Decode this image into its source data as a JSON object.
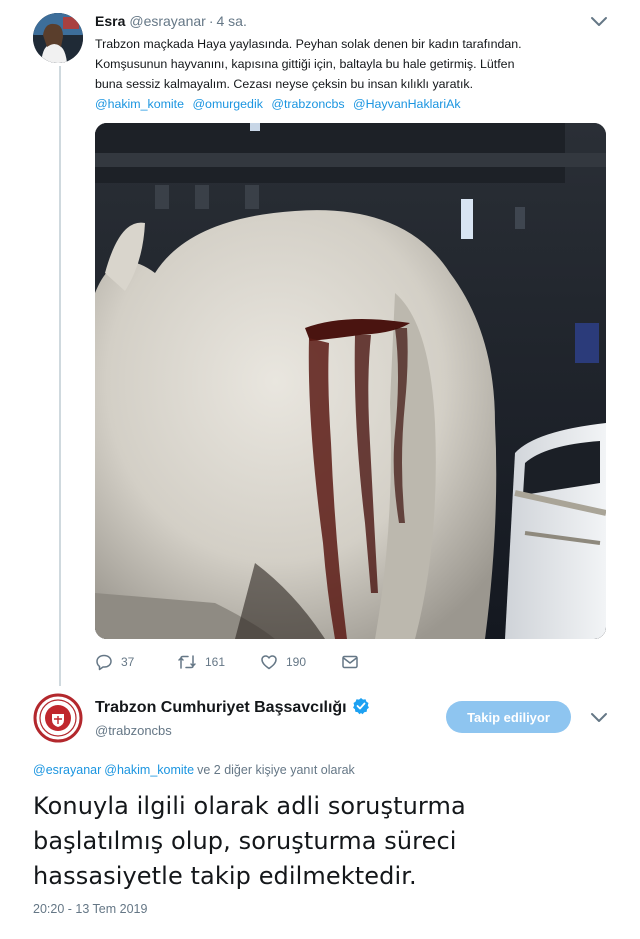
{
  "tweet": {
    "author_name": "Esra",
    "author_handle": "@esrayanar",
    "separator": "·",
    "time": "4 sa.",
    "text_lines": [
      "Trabzon maçkada Haya yaylasında. Peyhan solak denen bir kadın tarafından.",
      "Komşusunun hayvanını, kapısına gittiği için, baltayla bu hale getirmiş. Lütfen",
      "buna sessiz kalmayalım. Cezası neyse çeksin bu insan kılıklı yaratık."
    ],
    "mentions": [
      "@hakim_komite",
      "@omurgedik",
      "@trabzoncbs",
      "@HayvanHaklariAk"
    ],
    "actions": {
      "reply_count": "37",
      "retweet_count": "161",
      "like_count": "190"
    },
    "icons": {
      "reply": "reply-icon",
      "retweet": "retweet-icon",
      "like": "heart-icon",
      "message": "envelope-icon",
      "more": "chevron-down-icon"
    }
  },
  "reply": {
    "author_name": "Trabzon Cumhuriyet Başsavcılığı",
    "author_handle": "@trabzoncbs",
    "verified_icon": "verified-badge-icon",
    "follow_label": "Takip ediliyor",
    "reply_to": {
      "mentions": [
        "@esrayanar",
        "@hakim_komite"
      ],
      "suffix": "ve 2 diğer kişiye yanıt olarak"
    },
    "text_lines": [
      "Konuyla ilgili olarak adli soruşturma",
      "başlatılmış olup, soruşturma süreci",
      "hassasiyetle takip edilmektedir."
    ],
    "timestamp": "20:20 - 13 Tem 2019"
  },
  "colors": {
    "accent": "#1b95e0",
    "follow_button": "#8ec5f0",
    "muted_text": "#657786",
    "verified": "#1da1f2",
    "thread_line": "#cfd9de"
  }
}
